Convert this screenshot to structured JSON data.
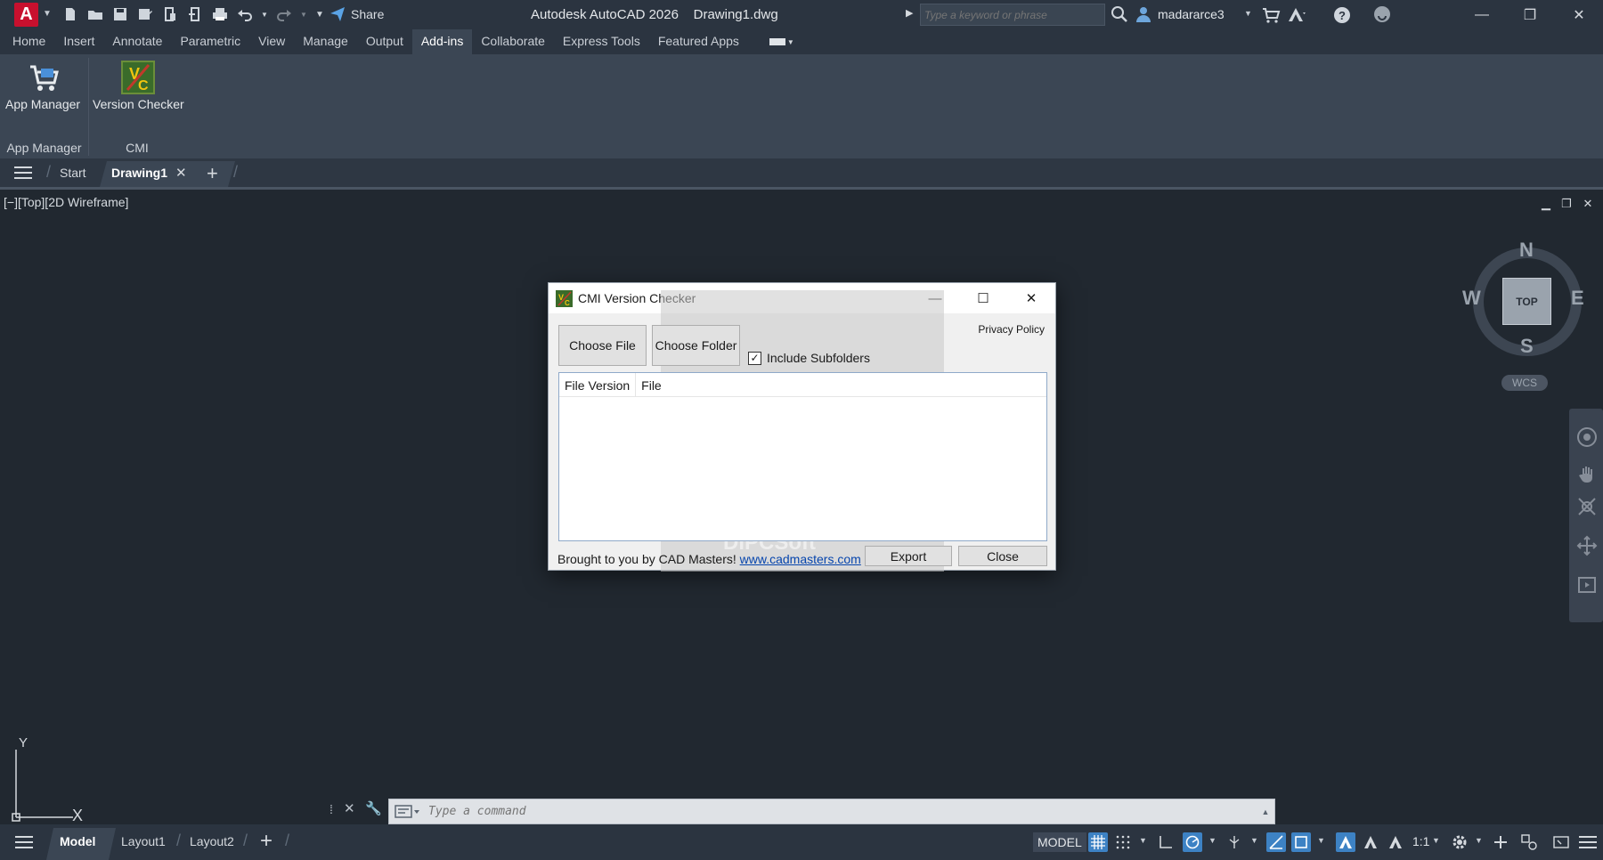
{
  "titlebar": {
    "app_letter": "A",
    "share_label": "Share",
    "title": "Autodesk AutoCAD 2026    Drawing1.dwg",
    "search_placeholder": "Type a keyword or phrase",
    "username": "madararce3"
  },
  "ribbon": {
    "tabs": [
      {
        "label": "Home"
      },
      {
        "label": "Insert"
      },
      {
        "label": "Annotate"
      },
      {
        "label": "Parametric"
      },
      {
        "label": "View"
      },
      {
        "label": "Manage"
      },
      {
        "label": "Output"
      },
      {
        "label": "Add-ins"
      },
      {
        "label": "Collaborate"
      },
      {
        "label": "Express Tools"
      },
      {
        "label": "Featured Apps"
      }
    ],
    "active_tab": "Add-ins",
    "groups": [
      {
        "button_label": "App Manager",
        "group_label": "App Manager"
      },
      {
        "button_label": "Version Checker",
        "group_label": "CMI"
      }
    ]
  },
  "file_tabs": {
    "start": "Start",
    "drawing": "Drawing1"
  },
  "viewport": {
    "label": "[−][Top][2D Wireframe]",
    "viewcube": {
      "top": "TOP",
      "n": "N",
      "s": "S",
      "e": "E",
      "w": "W",
      "wcs": "WCS"
    },
    "ucs": {
      "y": "Y",
      "x": "X"
    }
  },
  "command_line": {
    "placeholder": "Type a command"
  },
  "statusbar": {
    "tabs": [
      {
        "label": "Model"
      },
      {
        "label": "Layout1"
      },
      {
        "label": "Layout2"
      }
    ],
    "model_button": "MODEL",
    "scale": "1:1"
  },
  "dialog": {
    "title": "CMI Version Checker",
    "privacy_policy": "Privacy Policy",
    "choose_file": "Choose File",
    "choose_folder": "Choose Folder",
    "include_subfolders": "Include Subfolders",
    "include_subfolders_checked": true,
    "columns": [
      "File Version",
      "File"
    ],
    "credit_text": "Brought to you by CAD Masters!",
    "credit_link": "www.cadmasters.com",
    "export": "Export",
    "close": "Close",
    "watermark": "DiPCSoft"
  },
  "colors": {
    "app_red": "#c8102e",
    "accent_blue": "#3d82c4",
    "background": "#212830"
  }
}
